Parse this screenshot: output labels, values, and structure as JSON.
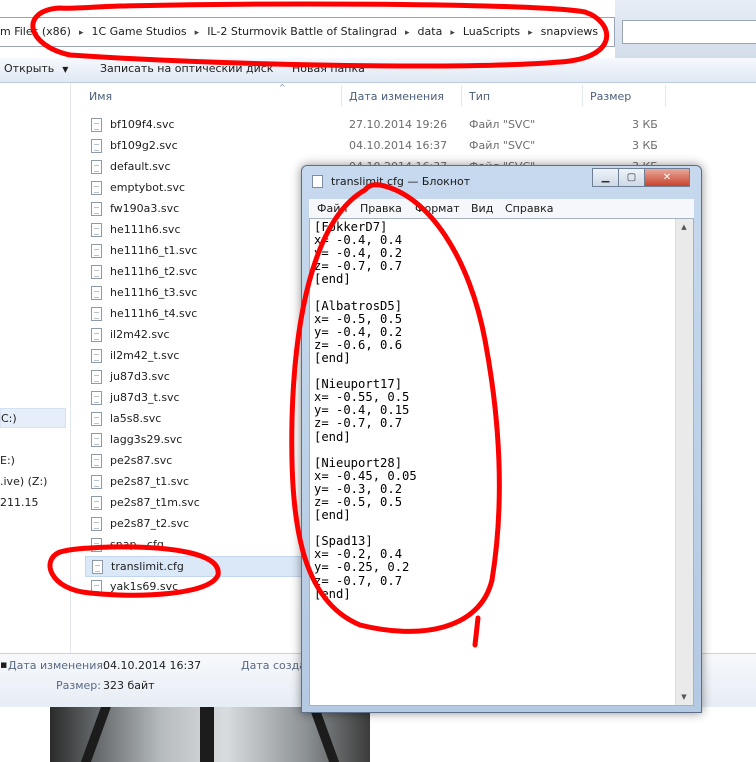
{
  "address_bar": {
    "segments": [
      "m Files (x86)",
      "1C Game Studios",
      "IL-2 Sturmovik Battle of Stalingrad",
      "data",
      "LuaScripts",
      "snapviews"
    ]
  },
  "toolbar": {
    "open_label": "Открыть",
    "burn_label": "Записать на оптический диск",
    "new_folder_label": "Новая папка"
  },
  "nav_pane": {
    "items": [
      "C:)",
      "E:)",
      ".ive) (Z:)",
      "211.15"
    ]
  },
  "columns": {
    "name": "Имя",
    "date": "Дата изменения",
    "type": "Тип",
    "size": "Размер"
  },
  "files": [
    {
      "name": "bf109f4.svc",
      "date": "27.10.2014 19:26",
      "type": "Файл \"SVC\"",
      "size": "3 КБ"
    },
    {
      "name": "bf109g2.svc",
      "date": "04.10.2014 16:37",
      "type": "Файл \"SVC\"",
      "size": "3 КБ"
    },
    {
      "name": "default.svc",
      "date": "04.10.2014 16:37",
      "type": "Файл \"SVC\"",
      "size": "3 КБ"
    },
    {
      "name": "emptybot.svc"
    },
    {
      "name": "fw190a3.svc"
    },
    {
      "name": "he111h6.svc"
    },
    {
      "name": "he111h6_t1.svc"
    },
    {
      "name": "he111h6_t2.svc"
    },
    {
      "name": "he111h6_t3.svc"
    },
    {
      "name": "he111h6_t4.svc"
    },
    {
      "name": "il2m42.svc"
    },
    {
      "name": "il2m42_t.svc"
    },
    {
      "name": "ju87d3.svc"
    },
    {
      "name": "ju87d3_t.svc"
    },
    {
      "name": "la5s8.svc"
    },
    {
      "name": "lagg3s29.svc"
    },
    {
      "name": "pe2s87.svc"
    },
    {
      "name": "pe2s87_t1.svc"
    },
    {
      "name": "pe2s87_t1m.svc"
    },
    {
      "name": "pe2s87_t2.svc"
    },
    {
      "name": "snap...cfg"
    },
    {
      "name": "translimit.cfg"
    },
    {
      "name": "yak1s69.svc"
    }
  ],
  "details": {
    "date_label": "Дата изменения:",
    "date_value": "04.10.2014 16:37",
    "size_label": "Размер:",
    "size_value": "323 байт",
    "created_label": "Дата созда"
  },
  "notepad": {
    "title": "translimit.cfg — Блокнот",
    "menu": [
      "Файл",
      "Правка",
      "Формат",
      "Вид",
      "Справка"
    ],
    "content": "[FokkerD7]\nx= -0.4, 0.4\ny= -0.4, 0.2\nz= -0.7, 0.7\n[end]\n\n[AlbatrosD5]\nx= -0.5, 0.5\ny= -0.4, 0.2\nz= -0.6, 0.6\n[end]\n\n[Nieuport17]\nx= -0.55, 0.5\ny= -0.4, 0.15\nz= -0.7, 0.7\n[end]\n\n[Nieuport28]\nx= -0.45, 0.05\ny= -0.3, 0.2\nz= -0.5, 0.5\n[end]\n\n[Spad13]\nx= -0.2, 0.4\ny= -0.25, 0.2\nz= -0.7, 0.7\n[end]"
  },
  "colors": {
    "annotation_red": "#ff0000",
    "selection_blue": "#dbe8f8",
    "menu_bg": "#f5f7fa"
  }
}
